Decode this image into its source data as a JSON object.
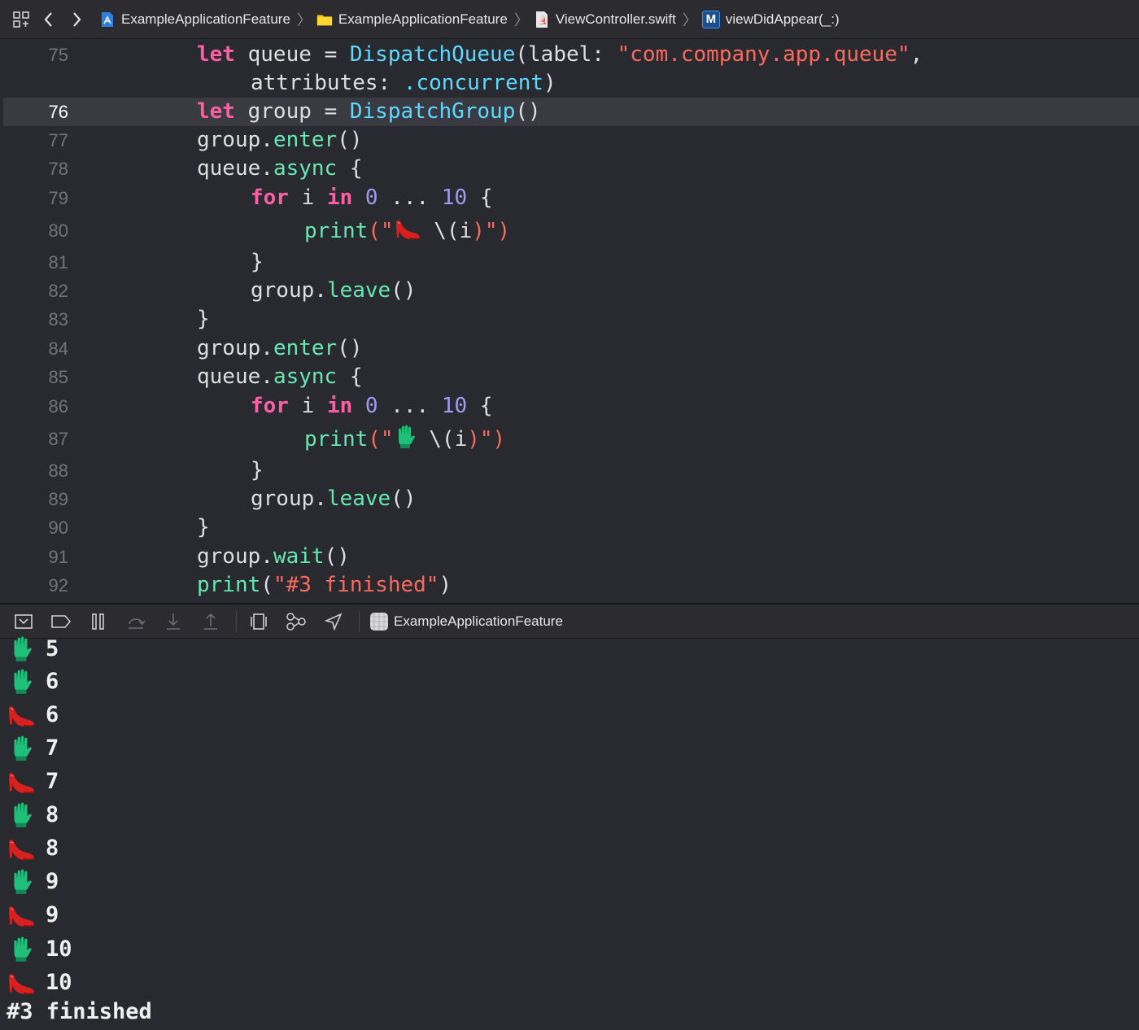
{
  "jumpbar": {
    "crumbs": [
      {
        "label": "ExampleApplicationFeature",
        "icon": "project-icon"
      },
      {
        "label": "ExampleApplicationFeature",
        "icon": "folder-icon"
      },
      {
        "label": "ViewController.swift",
        "icon": "swift-file-icon"
      },
      {
        "label": "viewDidAppear(_:)",
        "icon": "method-icon"
      }
    ],
    "method_badge": "M"
  },
  "editor": {
    "current_line": 76,
    "lines": [
      {
        "num": "75",
        "text": "let queue = DispatchQueue(label: \"com.company.app.queue\",\n        attributes: .concurrent)"
      },
      {
        "num": "76",
        "text": "let group = DispatchGroup()"
      },
      {
        "num": "77",
        "text": "group.enter()"
      },
      {
        "num": "78",
        "text": "queue.async {"
      },
      {
        "num": "79",
        "text": "for i in 0 ... 10 {"
      },
      {
        "num": "80",
        "text": "print(\"👠 \\(i)\")"
      },
      {
        "num": "81",
        "text": "}"
      },
      {
        "num": "82",
        "text": "group.leave()"
      },
      {
        "num": "83",
        "text": "}"
      },
      {
        "num": "84",
        "text": "group.enter()"
      },
      {
        "num": "85",
        "text": "queue.async {"
      },
      {
        "num": "86",
        "text": "for i in 0 ... 10 {"
      },
      {
        "num": "87",
        "text": "print(\"🧤 \\(i)\")"
      },
      {
        "num": "88",
        "text": "}"
      },
      {
        "num": "89",
        "text": "group.leave()"
      },
      {
        "num": "90",
        "text": "}"
      },
      {
        "num": "91",
        "text": "group.wait()"
      },
      {
        "num": "92",
        "text": "print(\"#3 finished\")"
      }
    ],
    "tokens": {
      "let": "let",
      "queue": "queue",
      "eq": "=",
      "DispatchQueue": "DispatchQueue",
      "label_arg": "(label: ",
      "label_str": "\"com.company.app.queue\"",
      "comma": ",",
      "attributes": "attributes: ",
      "concurrent": ".concurrent",
      "close_paren": ")",
      "group": "group",
      "DispatchGroup": "DispatchGroup",
      "parens": "()",
      "dot": ".",
      "enter": "enter",
      "async": "async",
      "open_brace": "{",
      "close_brace": "}",
      "for": "for",
      "i": "i",
      "in": "in",
      "zero": "0",
      "range": "...",
      "ten": "10",
      "print": "print",
      "open_quote": "(\"",
      "interp": "\\(",
      "close_quote": ")\")",
      "leave": "leave",
      "wait": "wait",
      "final_str": "\"#3 finished\""
    }
  },
  "debugbar": {
    "target": "ExampleApplicationFeature"
  },
  "console": {
    "lines": [
      {
        "emoji": "glove",
        "text": "5"
      },
      {
        "emoji": "glove",
        "text": "6"
      },
      {
        "emoji": "heel",
        "text": "6"
      },
      {
        "emoji": "glove",
        "text": "7"
      },
      {
        "emoji": "heel",
        "text": "7"
      },
      {
        "emoji": "glove",
        "text": "8"
      },
      {
        "emoji": "heel",
        "text": "8"
      },
      {
        "emoji": "glove",
        "text": "9"
      },
      {
        "emoji": "heel",
        "text": "9"
      },
      {
        "emoji": "glove",
        "text": "10"
      },
      {
        "emoji": "heel",
        "text": "10"
      }
    ],
    "final": "#3 finished"
  },
  "colors": {
    "background": "#292a30",
    "keyword": "#fc5fa3",
    "type": "#5dd8ff",
    "function": "#67e8b0",
    "string": "#fc6a5d",
    "number": "#a796f0",
    "current_line": "#3a3b42"
  }
}
